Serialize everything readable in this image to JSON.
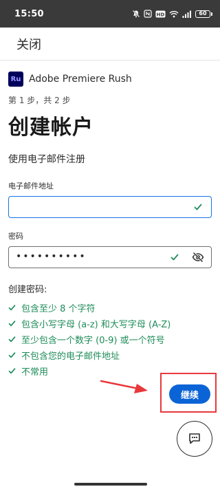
{
  "status_bar": {
    "time": "15:50",
    "battery": "60"
  },
  "header": {
    "close_label": "关闭"
  },
  "app": {
    "logo_text": "Ru",
    "name": "Adobe Premiere Rush"
  },
  "step": "第 1 步，共 2 步",
  "title": "创建帐户",
  "subtitle": "使用电子邮件注册",
  "email_field": {
    "label": "电子邮件地址",
    "value": ""
  },
  "password_field": {
    "label": "密码",
    "value": "••••••••••"
  },
  "rules": {
    "title": "创建密码:",
    "items": [
      "包含至少 8 个字符",
      "包含小写字母 (a-z) 和大写字母 (A-Z)",
      "至少包含一个数字 (0-9) 或一个符号",
      "不包含您的电子邮件地址",
      "不常用"
    ]
  },
  "continue_label": "继续",
  "colors": {
    "accent": "#0b64d6",
    "success": "#1e8c5a",
    "annotation": "#e8383b",
    "logo_bg": "#00005b",
    "logo_fg": "#9999ff"
  }
}
